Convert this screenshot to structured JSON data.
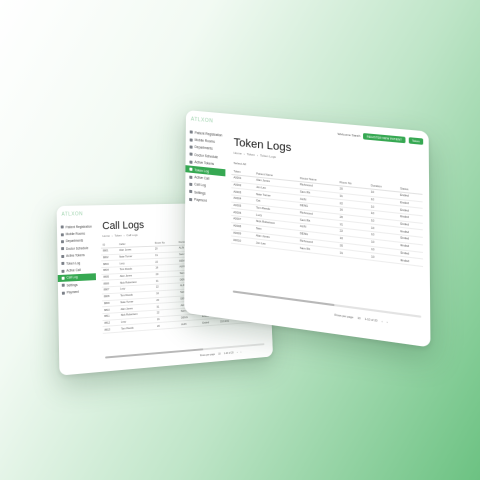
{
  "back": {
    "logo": "ATLXON",
    "sidebar": [
      {
        "label": "Patient Registration",
        "icon": "user-icon"
      },
      {
        "label": "Mobile Rooms",
        "icon": "room-icon"
      },
      {
        "label": "Departments",
        "icon": "building-icon"
      },
      {
        "label": "Doctor Schedule",
        "icon": "calendar-icon"
      },
      {
        "label": "Active Tokens",
        "icon": "token-icon"
      },
      {
        "label": "Token Log",
        "icon": "list-icon"
      },
      {
        "label": "Active Call",
        "icon": "phone-icon"
      },
      {
        "label": "Call Log",
        "icon": "call-log-icon",
        "active": true
      },
      {
        "label": "Settings",
        "icon": "gear-icon"
      },
      {
        "label": "Payment",
        "icon": "card-icon"
      }
    ],
    "title": "Call Logs",
    "breadcrumb": [
      "Home",
      "Token",
      "Call Logs"
    ],
    "columns": [
      "ID",
      "Caller",
      "Room No",
      "Doctor",
      "Status",
      "Start Time",
      "End Time"
    ],
    "rows": [
      [
        "8801",
        "Alan Jones",
        "20",
        "ALIN",
        "Ended",
        "15:06:01",
        "15:08:1"
      ],
      [
        "8802",
        "Nate Turner",
        "31",
        "Sam Rh",
        "Ended",
        "15:06:01",
        "15:08:1"
      ],
      [
        "8803",
        "Lucy",
        "22",
        "DENG",
        "Ended",
        "15:07:01",
        "15:08:1"
      ],
      [
        "8804",
        "Tom Reeds",
        "16",
        "ALIN",
        "Ended",
        "15:07:01",
        "15:08:1"
      ],
      [
        "8805",
        "Alan Jones",
        "20",
        "Sam Rh",
        "Ended",
        "15:08:01",
        "15:09:1"
      ],
      [
        "8806",
        "Nick Robertson",
        "31",
        "DENG",
        "Ended",
        "15:08:01",
        "15:09:1"
      ],
      [
        "8807",
        "Lucy",
        "22",
        "ALIN",
        "Ended",
        "15:09:01",
        "15:10:1"
      ],
      [
        "8808",
        "Tom Reeds",
        "16",
        "Sam Rh",
        "Ended",
        "15:10:01",
        "15:11:1"
      ],
      [
        "8809",
        "Nate Turner",
        "20",
        "DENG",
        "Ended",
        "15:10:01",
        "15:11:1"
      ],
      [
        "8810",
        "Alan Jones",
        "31",
        "ALIN",
        "Ended",
        "15:11:01",
        "15:12:1"
      ],
      [
        "8811",
        "Nick Robertson",
        "22",
        "Sam Rh",
        "Ended",
        "15:12:01",
        "15:13:1"
      ],
      [
        "8812",
        "Lucy",
        "16",
        "DENG",
        "Ended",
        "15:12:01",
        "15:13:1"
      ],
      [
        "8813",
        "Tom Reeds",
        "20",
        "ALIN",
        "Ended",
        "15:13:01",
        "15:14:1"
      ]
    ],
    "pager": {
      "rows_label": "Rows per page",
      "rows_value": "10",
      "range": "1-10 of 20"
    }
  },
  "front": {
    "logo": "ATLXON",
    "sidebar": [
      {
        "label": "Patient Registration",
        "icon": "user-icon"
      },
      {
        "label": "Mobile Rooms",
        "icon": "room-icon"
      },
      {
        "label": "Departments",
        "icon": "building-icon"
      },
      {
        "label": "Doctor Schedule",
        "icon": "calendar-icon"
      },
      {
        "label": "Active Tokens",
        "icon": "token-icon"
      },
      {
        "label": "Token Log",
        "icon": "list-icon",
        "active": true
      },
      {
        "label": "Active Call",
        "icon": "phone-icon"
      },
      {
        "label": "Call Log",
        "icon": "call-log-icon"
      },
      {
        "label": "Settings",
        "icon": "gear-icon"
      },
      {
        "label": "Payment",
        "icon": "card-icon"
      }
    ],
    "topbar": {
      "welcome": "Welcome Sarah",
      "primary_button": "REGISTER NEW PATIENT",
      "secondary_button": "Token"
    },
    "title": "Token Logs",
    "breadcrumb": [
      "Home",
      "Token",
      "Token Logs"
    ],
    "filter": "Select All",
    "columns": [
      "Token",
      "Patient Name",
      "Doctor Name",
      "Room No",
      "Duration",
      "Status"
    ],
    "rows": [
      [
        "A0001",
        "Alan Jones",
        "Richmond",
        "20",
        "10",
        "Ended"
      ],
      [
        "A0002",
        "Jon Lee",
        "Sam Rh",
        "31",
        "10",
        "Ended"
      ],
      [
        "A0003",
        "Nate Turner",
        "ALIN",
        "22",
        "10",
        "Ended"
      ],
      [
        "A0004",
        "Cat",
        "DENG",
        "16",
        "10",
        "Ended"
      ],
      [
        "A0005",
        "Tom Reeds",
        "Richmond",
        "20",
        "10",
        "Ended"
      ],
      [
        "A0006",
        "Lucy",
        "Sam Rh",
        "31",
        "10",
        "Ended"
      ],
      [
        "A0007",
        "Nick Robertson",
        "ALIN",
        "22",
        "10",
        "Ended"
      ],
      [
        "A0008",
        "Sam",
        "DENG",
        "16",
        "10",
        "Ended"
      ],
      [
        "A0009",
        "Alan Jones",
        "Richmond",
        "20",
        "10",
        "Ended"
      ],
      [
        "A0010",
        "Jon Lee",
        "Sam Rh",
        "31",
        "10",
        "Ended"
      ]
    ],
    "pager": {
      "rows_label": "Rows per page",
      "rows_value": "10",
      "range": "1-10 of 20"
    }
  },
  "colors": {
    "accent": "#36a852",
    "logo": "#9fd3ae",
    "background_end": "#6cc282"
  }
}
